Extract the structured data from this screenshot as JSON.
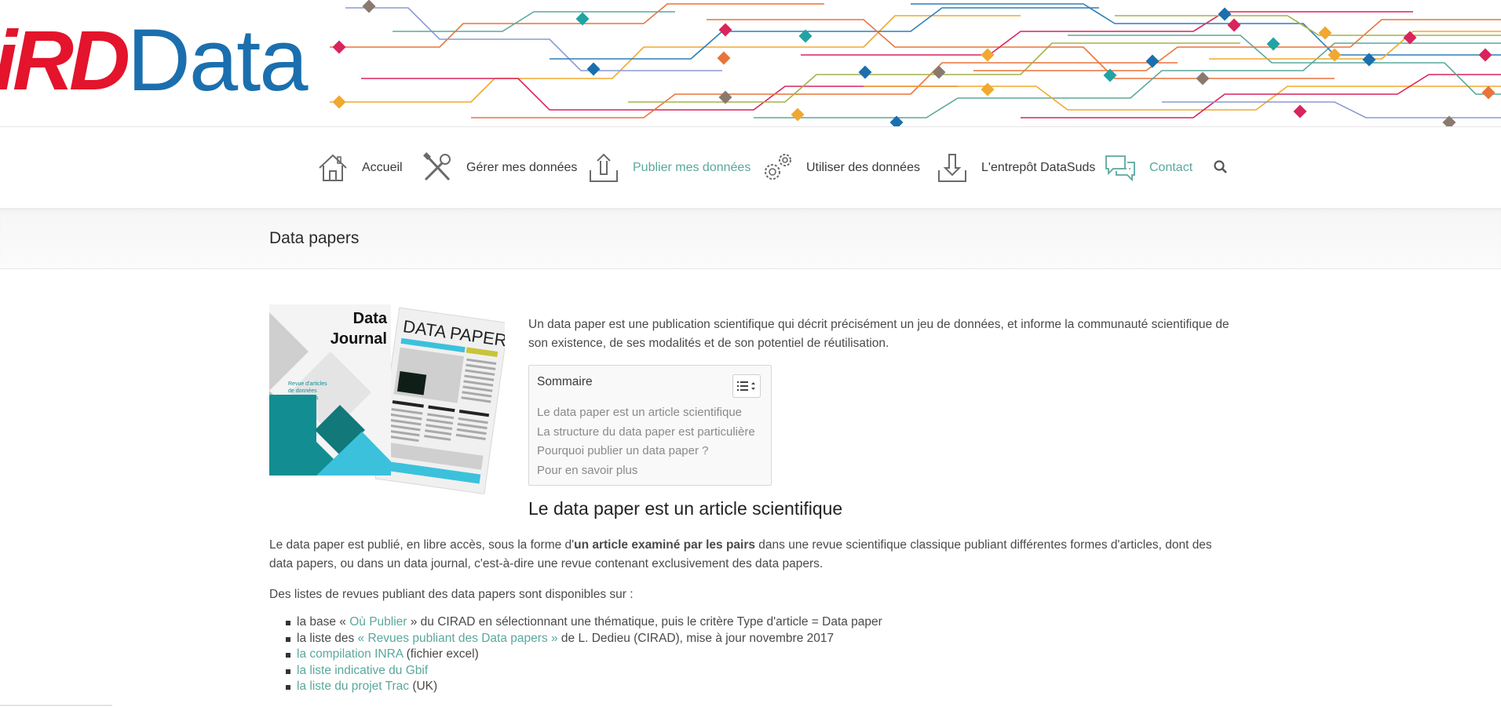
{
  "colors": {
    "accent": "#5aa89c",
    "logo_red": "#e3142b",
    "logo_blue": "#1b6fae"
  },
  "logo": {
    "part1": "iRD",
    "part2": "Data"
  },
  "nav": {
    "items": [
      {
        "label": "Accueil",
        "icon": "home-icon",
        "active": false
      },
      {
        "label": "Gérer mes données",
        "icon": "tools-icon",
        "active": false
      },
      {
        "label": "Publier mes données",
        "icon": "upload-icon",
        "active": true
      },
      {
        "label": "Utiliser des données",
        "icon": "gears-icon",
        "active": false
      },
      {
        "label": "L'entrepôt DataSuds",
        "icon": "download-icon",
        "active": false
      },
      {
        "label": "Contact",
        "icon": "chat-icon",
        "active": true
      }
    ],
    "search_icon": "search-icon"
  },
  "page": {
    "title": "Data papers"
  },
  "illustration": {
    "journal_title_line1": "Data",
    "journal_title_line2": "Journal",
    "journal_caption_line1": "Revue d'articles",
    "journal_caption_line2": "de données",
    "journal_caption_line3": "scientifiques",
    "paper_title": "DATA PAPER"
  },
  "content": {
    "intro": "Un data paper est une publication scientifique qui décrit précisément un jeu de données, et informe la communauté scientifique de son existence, de ses modalités et de son potentiel de réutilisation.",
    "toc": {
      "title": "Sommaire",
      "toggle_icon": "list-toggle-icon",
      "items": [
        "Le data paper est un article scientifique",
        "La structure du data paper est particulière",
        "Pourquoi publier un data paper ?",
        "Pour en savoir plus"
      ]
    },
    "section_heading": "Le data paper est un article scientifique",
    "para1": {
      "before": "Le data paper est publié, en libre accès, sous la forme d'",
      "bold": "un article examiné par les pairs",
      "after": " dans une revue scientifique classique publiant différentes formes d'articles, dont des data papers, ou dans un data journal, c'est-à-dire une revue contenant exclusivement des data papers."
    },
    "para2": "Des listes de revues publiant des data papers sont disponibles sur :",
    "links": [
      {
        "before": "la base « ",
        "link": "Où Publier",
        "after": " » du CIRAD en sélectionnant une thématique, puis le critère Type d'article = Data paper"
      },
      {
        "before": "la liste des ",
        "link": "« Revues publiant des Data papers »",
        "after": " de L. Dedieu (CIRAD), mise à jour novembre 2017"
      },
      {
        "before": "",
        "link": "la compilation INRA",
        "after": " (fichier excel)"
      },
      {
        "before": "",
        "link": "la liste indicative du Gbif",
        "after": ""
      },
      {
        "before": "",
        "link": "la liste du projet Trac",
        "after": " (UK)"
      }
    ]
  }
}
